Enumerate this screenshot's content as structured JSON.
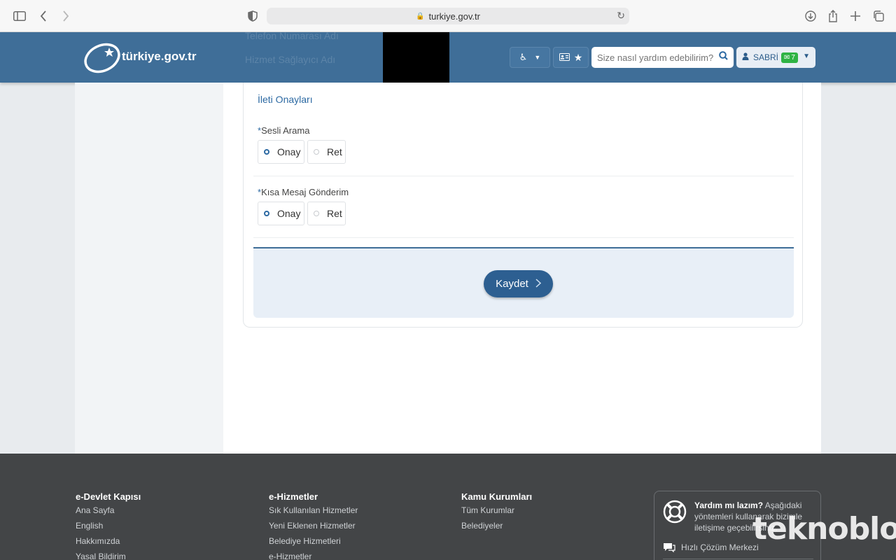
{
  "browser": {
    "url": "turkiye.gov.tr"
  },
  "header": {
    "logo_text": "türkiye.gov.tr",
    "ghost_lines": [
      "Telefon Numarası Adı",
      "Hizmet Sağlayıcı Adı"
    ],
    "search_placeholder": "Size nasıl yardım edebilirim?",
    "user_name": "SABRİ",
    "message_count": "7"
  },
  "form": {
    "section_title": "İleti Onayları",
    "fields": [
      {
        "required_mark": "*",
        "label": "Sesli Arama",
        "options": [
          "Onay",
          "Ret"
        ],
        "selected": "Onay"
      },
      {
        "required_mark": "*",
        "label": "Kısa Mesaj Gönderim",
        "options": [
          "Onay",
          "Ret"
        ],
        "selected": "Onay"
      }
    ],
    "save_label": "Kaydet"
  },
  "footer": {
    "columns": [
      {
        "title": "e-Devlet Kapısı",
        "links": [
          "Ana Sayfa",
          "English",
          "Hakkımızda",
          "Yasal Bildirim"
        ]
      },
      {
        "title": "e-Hizmetler",
        "links": [
          "Sık Kullanılan Hizmetler",
          "Yeni Eklenen Hizmetler",
          "Belediye Hizmetleri",
          "e-Hizmetler"
        ]
      },
      {
        "title": "Kamu Kurumları",
        "links": [
          "Tüm Kurumlar",
          "Belediyeler"
        ]
      }
    ],
    "help": {
      "title": "Yardım mı lazım?",
      "text": "Aşağıdaki yöntemleri kullanarak bizimle iletişime geçebilirsiniz.",
      "link": "Hızlı Çözüm Merkezi"
    }
  },
  "watermark": "teknoblog"
}
